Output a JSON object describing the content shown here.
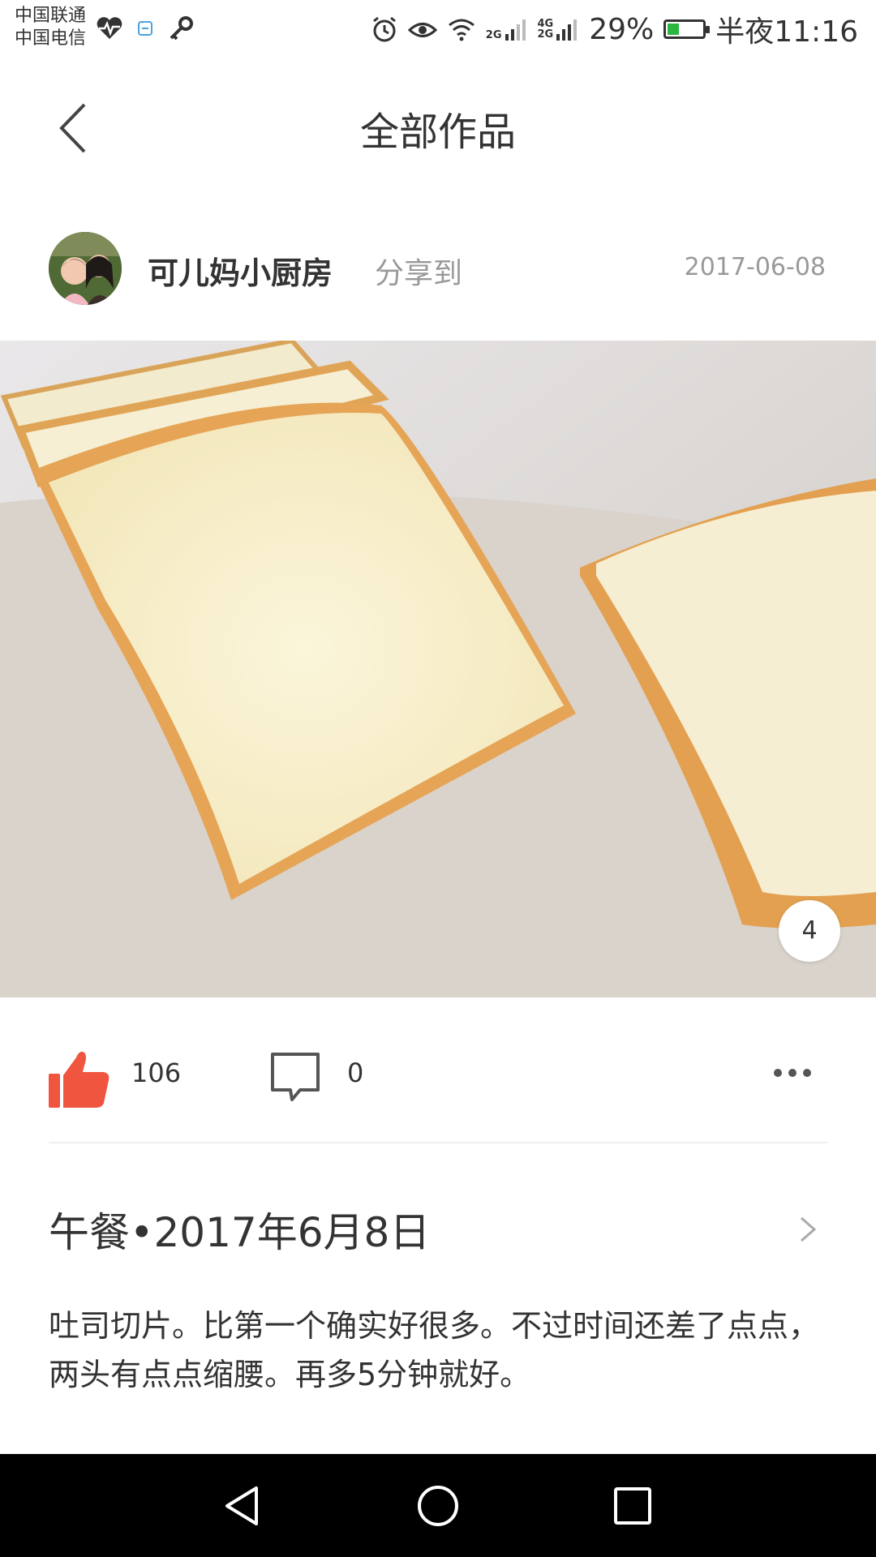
{
  "status_bar": {
    "carrier_1": "中国联通",
    "carrier_2": "中国电信",
    "network_1": "2G",
    "network_2a": "4G",
    "network_2b": "2G",
    "battery": "29%",
    "time": "半夜11:16",
    "icons": [
      "heartbeat-icon",
      "app-notification-icon",
      "key-icon",
      "alarm-icon",
      "eye-icon",
      "wifi-icon",
      "signal-icon",
      "battery-icon"
    ]
  },
  "header": {
    "title": "全部作品"
  },
  "post": {
    "author": "可儿妈小厨房",
    "share_label": "分享到",
    "date": "2017-06-08",
    "image_count": "4",
    "likes": "106",
    "comments": "0",
    "meal_title": "午餐•2017年6月8日",
    "description": "吐司切片。比第一个确实好很多。不过时间还差了点点，两头有点点缩腰。再多5分钟就好。"
  },
  "colors": {
    "like_red": "#f0553f",
    "text_dark": "#333333",
    "text_gray": "#999999",
    "nav_bg": "#000000"
  }
}
